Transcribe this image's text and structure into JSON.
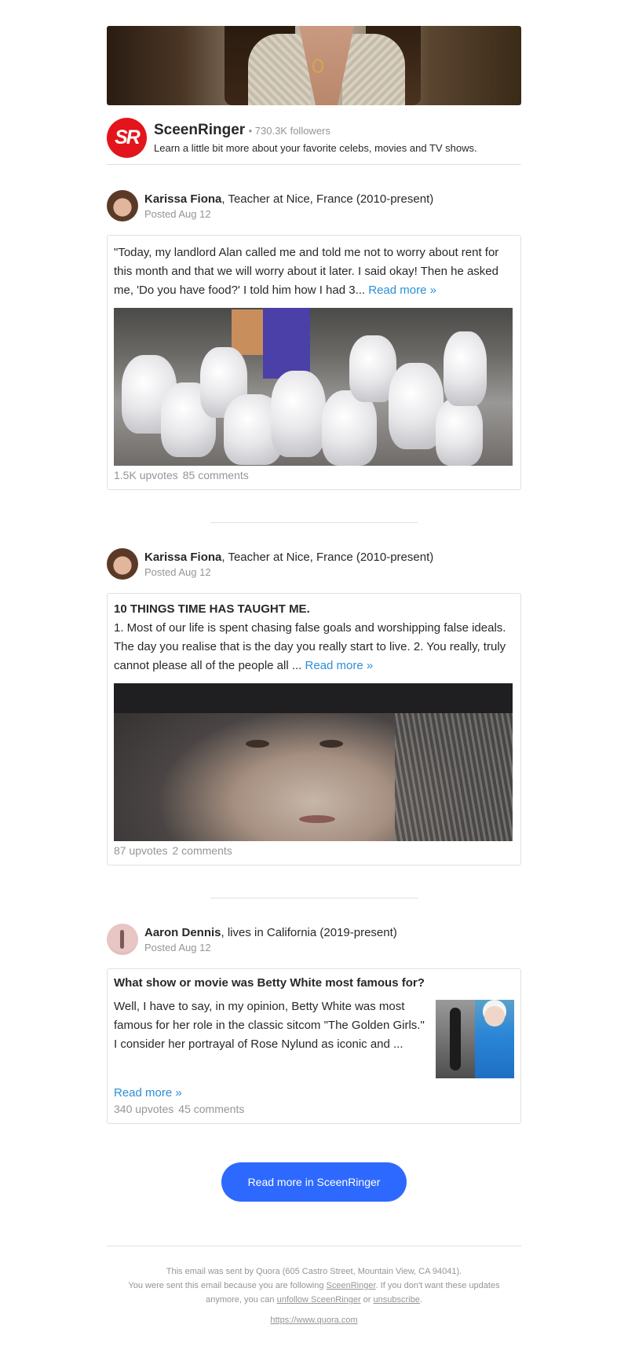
{
  "space": {
    "logo_text": "SR",
    "name": "SceenRinger",
    "followers": "• 730.3K followers",
    "description": "Learn a little bit more about your favorite celebs, movies and TV shows."
  },
  "posts": [
    {
      "author": "Karissa Fiona",
      "credential": ", Teacher at Nice, France (2010-present)",
      "posted": "Posted Aug 12",
      "title": "",
      "excerpt": "\"Today, my landlord Alan called me and told me not to worry about rent for this month and that we will worry about it later. I said okay! Then he asked me, 'Do you have food?' I told him how I had 3...",
      "read_more": "Read more »",
      "upvotes": "1.5K upvotes",
      "comments": "85 comments"
    },
    {
      "author": "Karissa Fiona",
      "credential": ", Teacher at Nice, France (2010-present)",
      "posted": "Posted Aug 12",
      "title": "10 THINGS TIME HAS TAUGHT ME.",
      "excerpt": "1. Most of our life is spent chasing false goals and worshipping false ideals. The day you realise that is the day you really start to live. 2. You really, truly cannot please all of the people all ...",
      "read_more": "Read more »",
      "upvotes": "87 upvotes",
      "comments": "2 comments"
    },
    {
      "author": "Aaron Dennis",
      "credential": ", lives in California (2019-present)",
      "posted": "Posted Aug 12",
      "title": "What show or movie was Betty White most famous for?",
      "excerpt": "Well, I have to say, in my opinion, Betty White was most famous for her role in the classic sitcom \"The Golden Girls.\" I consider her portrayal of Rose Nylund as iconic and ...",
      "read_more": "Read more »",
      "upvotes": "340 upvotes",
      "comments": "45 comments"
    }
  ],
  "cta": {
    "label": "Read more in SceenRinger"
  },
  "footer": {
    "line1": "This email was sent by Quora (605 Castro Street, Mountain View, CA 94041).",
    "line2_pre": "You were sent this email because you are following ",
    "line2_link": "SceenRinger",
    "line2_post": ". If you don't want these updates",
    "line3_pre": "anymore, you can ",
    "line3_link1": "unfollow SceenRinger",
    "line3_mid": " or ",
    "line3_link2": "unsubscribe",
    "line3_post": ".",
    "site": "https://www.quora.com"
  },
  "colors": {
    "accent": "#2e69ff",
    "link": "#2b8fd6",
    "logo": "#e3141b",
    "muted": "#939598"
  },
  "icons": {
    "space_logo": "sceenringer-logo",
    "avatars": [
      "avatar-karissa",
      "avatar-karissa",
      "avatar-aaron"
    ]
  }
}
